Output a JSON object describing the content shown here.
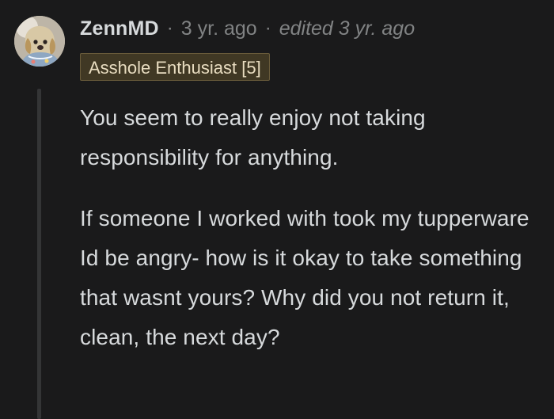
{
  "comment": {
    "author": "ZennMD",
    "separator": "·",
    "time_ago": "3 yr. ago",
    "edited": "edited 3 yr. ago",
    "flair": "Asshole Enthusiast [5]",
    "avatar_icon": "dog-avatar-icon",
    "paragraphs": [
      "You seem to really enjoy not taking responsibility for anything.",
      "If someone I worked with took my tupperware Id be angry- how is it okay to take something that wasnt yours? Why did you not return it, clean, the next day?"
    ]
  },
  "colors": {
    "background": "#1a1a1b",
    "text": "#d7dadc",
    "muted": "#818384",
    "flair_bg": "#403824",
    "thread_line": "#343536"
  }
}
